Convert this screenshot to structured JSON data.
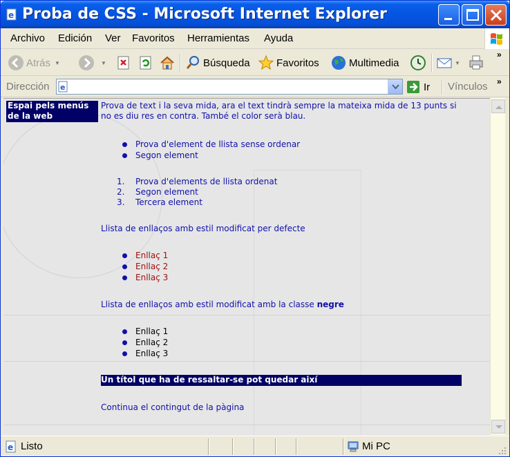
{
  "window": {
    "title": "Proba de CSS - Microsoft Internet Explorer"
  },
  "menubar": {
    "items": [
      "Archivo",
      "Edición",
      "Ver",
      "Favoritos",
      "Herramientas",
      "Ayuda"
    ]
  },
  "toolbar": {
    "back_label": "Atrás",
    "search_label": "Búsqueda",
    "favorites_label": "Favoritos",
    "media_label": "Multimedia"
  },
  "addressbar": {
    "label": "Dirección",
    "value": "",
    "go_label": "Ir",
    "links_label": "Vínculos"
  },
  "page": {
    "menu_space": "Espai pels menús de la web",
    "intro": "Prova de text i la seva mida, ara el text tindrà sempre la mateixa mida de 13 punts si no es diu res en contra. També el color serà blau.",
    "unordered": [
      "Prova d'element de llista sense ordenar",
      "Segon element"
    ],
    "ordered": [
      "Prova d'elements de llista ordenat",
      "Segon element",
      "Tercera element"
    ],
    "ordered_numbers": [
      "1.",
      "2.",
      "3."
    ],
    "links_default_heading": "Llista de enllaços amb estil modificat per defecte",
    "links_default": [
      "Enllaç 1",
      "Enllaç 2",
      "Enllaç 3"
    ],
    "links_class_heading_prefix": "Llista de enllaços amb estil modificat amb la classe ",
    "links_class_heading_bold": "negre",
    "links_class": [
      "Enllaç 1",
      "Enllaç 2",
      "Enllaç 3"
    ],
    "highlight_title": "Un títol que ha de ressaltar-se pot quedar així",
    "continue_text": "Continua el contingut de la pàgina"
  },
  "statusbar": {
    "text": "Listo",
    "zone": "Mi PC"
  }
}
